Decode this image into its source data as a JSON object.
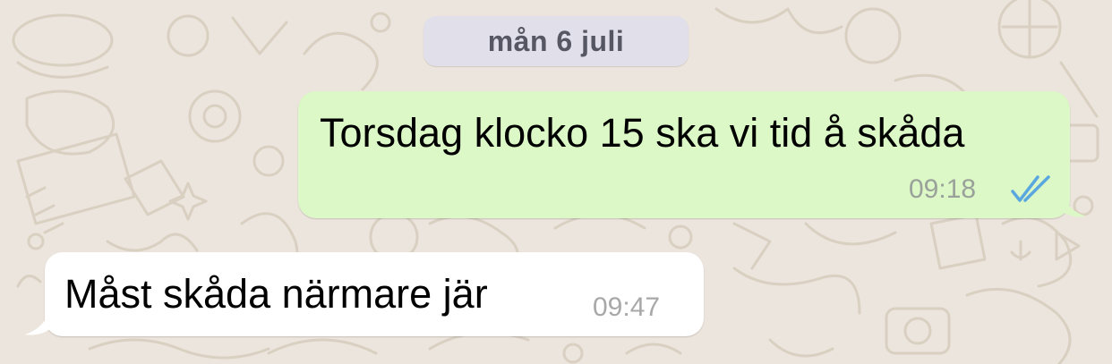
{
  "chat": {
    "date_divider": "mån 6 juli",
    "messages": [
      {
        "direction": "outgoing",
        "text": "Torsdag klocko 15 ska vi tid å skåda",
        "time": "09:18",
        "status_icon": "double-check-read-icon"
      },
      {
        "direction": "incoming",
        "text": "Måst skåda närmare jär",
        "time": "09:47"
      }
    ]
  },
  "colors": {
    "wallpaper": "#ece5dd",
    "outgoing_bubble": "#dcf8c6",
    "incoming_bubble": "#ffffff",
    "read_ticks": "#5aa7e0",
    "date_pill": "#e1e0ea"
  }
}
